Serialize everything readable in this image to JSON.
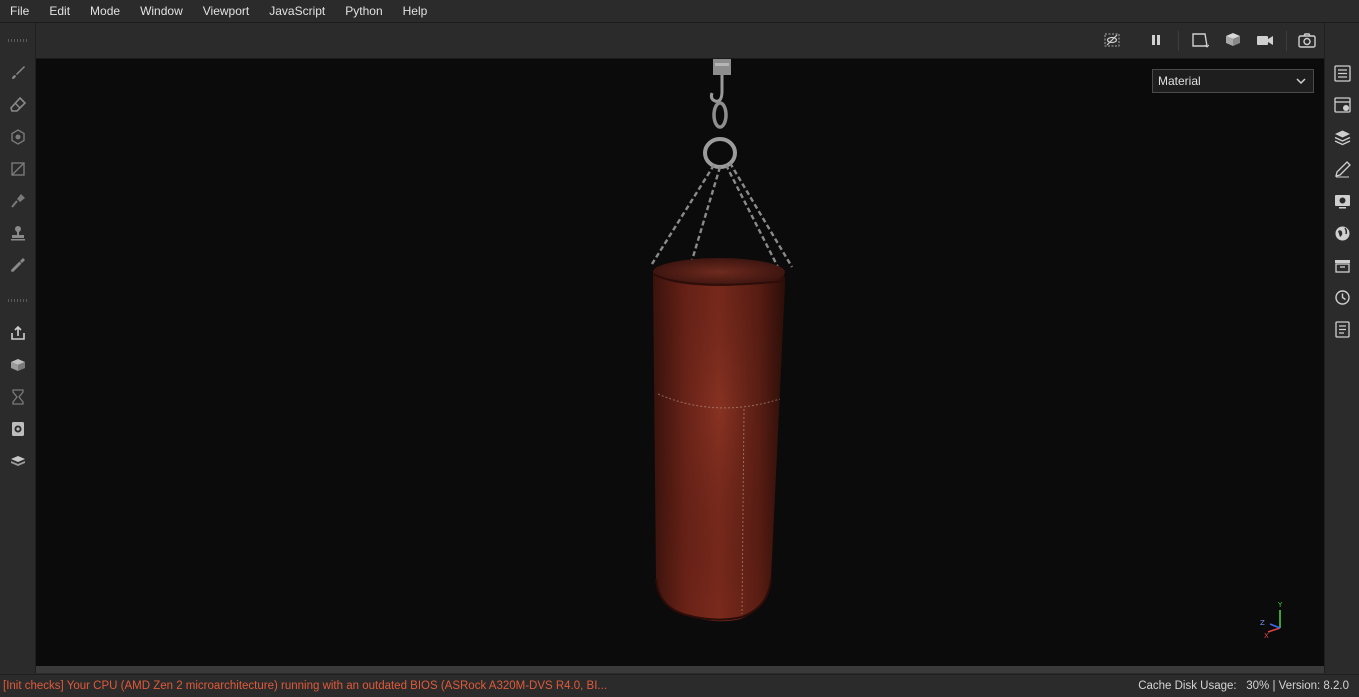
{
  "menu": [
    "File",
    "Edit",
    "Mode",
    "Window",
    "Viewport",
    "JavaScript",
    "Python",
    "Help"
  ],
  "left_toolbar": {
    "icons": [
      "paint-brush-icon",
      "eraser-icon",
      "projection-icon",
      "polygon-fill-icon",
      "smudge-icon",
      "clone-stamp-icon",
      "color-picker-icon",
      "export-icon",
      "bake-icon",
      "hourglass-icon",
      "display-settings-icon",
      "texture-set-icon"
    ]
  },
  "right_toolbar": {
    "icons": [
      "layers-list-icon",
      "texture-set-settings-icon",
      "layers-icon",
      "properties-icon",
      "display-settings-icon",
      "environment-icon",
      "assets-shelf-icon",
      "history-icon",
      "log-icon"
    ]
  },
  "viewport_header": {
    "icons": [
      "hide-ui-icon",
      "pause-icon",
      "2d-view-icon",
      "3d-view-icon",
      "camera-icon",
      "screenshot-icon"
    ]
  },
  "viewport": {
    "shading_mode": "Material",
    "axis_labels": {
      "x": "X",
      "y": "Y",
      "z": "Z"
    },
    "colors": {
      "background": "#0b0b0b",
      "bag_leather": "#6e2418",
      "chain": "#9a9a9a"
    }
  },
  "status": {
    "message": "[Init checks] Your CPU (AMD Zen 2 microarchitecture) running with an outdated BIOS (ASRock A320M-DVS R4.0, BI...",
    "cache_label": "Cache Disk Usage:",
    "cache_value": "30%",
    "separator": "|",
    "version_label": "Version:",
    "version_value": "8.2.0"
  }
}
